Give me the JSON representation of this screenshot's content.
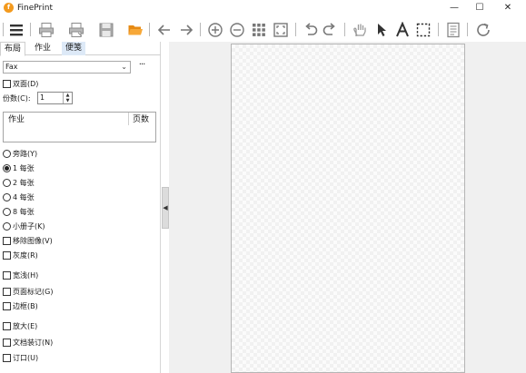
{
  "window": {
    "title": "FinePrint",
    "app_icon_glyph": "f",
    "controls": {
      "minimize": "—",
      "maximize": "☐",
      "close": "✕"
    }
  },
  "toolbar": {
    "icons": [
      "menu-icon",
      "print-icon",
      "save-as-pdf-icon",
      "save-icon",
      "open-folder-icon",
      "back-arrow-icon",
      "forward-arrow-icon",
      "zoom-in-icon",
      "zoom-out-icon",
      "thumbnail-grid-icon",
      "fit-page-icon",
      "undo-icon",
      "redo-icon",
      "hand-icon",
      "pointer-icon",
      "text-icon",
      "select-rectangle-icon",
      "notes-icon",
      "refresh-icon"
    ]
  },
  "tabs": [
    {
      "label": "布局",
      "active": true
    },
    {
      "label": "作业",
      "active": false
    },
    {
      "label": "便笺",
      "active": false
    }
  ],
  "printer": {
    "value": "Fax",
    "more_label": "···"
  },
  "duplex": {
    "label": "双面(D)",
    "checked": false
  },
  "copies": {
    "label": "份数(C):",
    "value": "1"
  },
  "job_list": {
    "columns": [
      "作业",
      "页数"
    ]
  },
  "layout_options": [
    {
      "label": "旁路(Y)",
      "selected": false
    },
    {
      "label": "1 每张",
      "selected": true
    },
    {
      "label": "2 每张",
      "selected": false
    },
    {
      "label": "4 每张",
      "selected": false
    },
    {
      "label": "8 每张",
      "selected": false
    },
    {
      "label": "小册子(K)",
      "selected": false
    }
  ],
  "options_group_1": [
    {
      "label": "移除图像(V)",
      "checked": false
    },
    {
      "label": "灰度(R)",
      "checked": false
    }
  ],
  "options_group_2": [
    {
      "label": "宽浅(H)",
      "checked": false
    },
    {
      "label": "页面标记(G)",
      "checked": false
    },
    {
      "label": "边框(B)",
      "checked": false
    }
  ],
  "options_group_3": [
    {
      "label": "放大(E)",
      "checked": false
    },
    {
      "label": "文档装订(N)",
      "checked": false
    },
    {
      "label": "订口(U)",
      "checked": false
    }
  ],
  "accent_color": "#f39a1e",
  "canvas_background": "#f0f0f0"
}
